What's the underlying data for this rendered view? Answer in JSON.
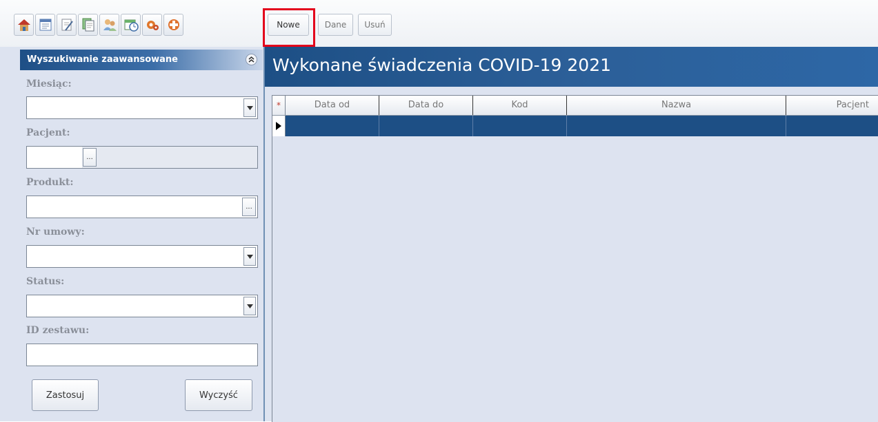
{
  "toolbar": {
    "icons": [
      {
        "name": "home-icon"
      },
      {
        "name": "calendar-list-icon"
      },
      {
        "name": "document-pen-icon"
      },
      {
        "name": "documents-icon"
      },
      {
        "name": "patients-icon"
      },
      {
        "name": "schedule-clock-icon"
      },
      {
        "name": "settings-gear-icon"
      },
      {
        "name": "medical-services-icon"
      }
    ],
    "buttons": {
      "new": "Nowe",
      "data": "Dane",
      "delete": "Usuń"
    }
  },
  "search_panel": {
    "title": "Wyszukiwanie zaawansowane",
    "fields": {
      "month": {
        "label": "Miesiąc:",
        "value": ""
      },
      "patient": {
        "label": "Pacjent:",
        "value": ""
      },
      "product": {
        "label": "Produkt:",
        "value": ""
      },
      "contract": {
        "label": "Nr umowy:",
        "value": ""
      },
      "status": {
        "label": "Status:",
        "value": ""
      },
      "set_id": {
        "label": "ID zestawu:",
        "value": ""
      }
    },
    "apply_label": "Zastosuj",
    "clear_label": "Wyczyść"
  },
  "main": {
    "title": "Wykonane świadczenia COVID-19 2021",
    "columns": [
      "Data od",
      "Data do",
      "Kod",
      "Nazwa",
      "Pacjent"
    ],
    "rows": []
  },
  "colors": {
    "header_blue": "#1d4f85",
    "panel_bg": "#dde3f0",
    "highlight_red": "#e3001b"
  }
}
